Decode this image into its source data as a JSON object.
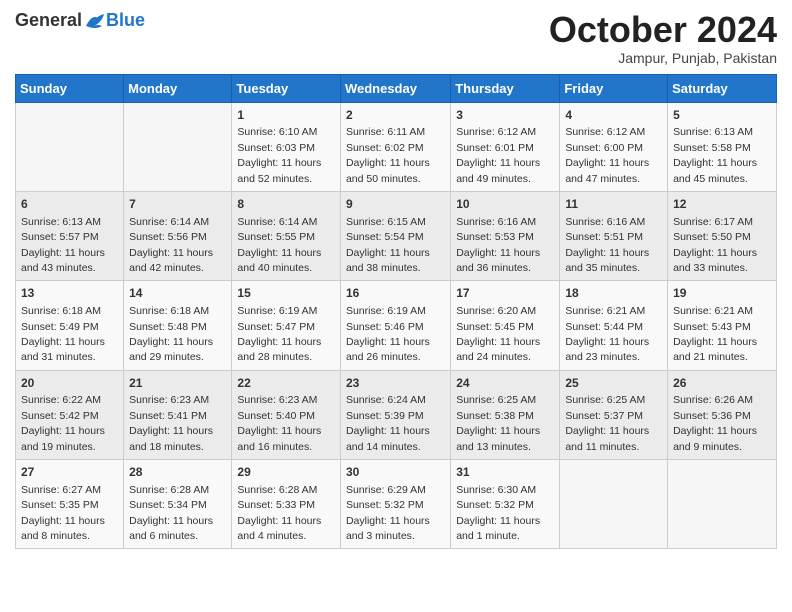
{
  "header": {
    "logo_general": "General",
    "logo_blue": "Blue",
    "month_title": "October 2024",
    "subtitle": "Jampur, Punjab, Pakistan"
  },
  "days_of_week": [
    "Sunday",
    "Monday",
    "Tuesday",
    "Wednesday",
    "Thursday",
    "Friday",
    "Saturday"
  ],
  "weeks": [
    [
      {
        "day": "",
        "info": ""
      },
      {
        "day": "",
        "info": ""
      },
      {
        "day": "1",
        "info": "Sunrise: 6:10 AM\nSunset: 6:03 PM\nDaylight: 11 hours and 52 minutes."
      },
      {
        "day": "2",
        "info": "Sunrise: 6:11 AM\nSunset: 6:02 PM\nDaylight: 11 hours and 50 minutes."
      },
      {
        "day": "3",
        "info": "Sunrise: 6:12 AM\nSunset: 6:01 PM\nDaylight: 11 hours and 49 minutes."
      },
      {
        "day": "4",
        "info": "Sunrise: 6:12 AM\nSunset: 6:00 PM\nDaylight: 11 hours and 47 minutes."
      },
      {
        "day": "5",
        "info": "Sunrise: 6:13 AM\nSunset: 5:58 PM\nDaylight: 11 hours and 45 minutes."
      }
    ],
    [
      {
        "day": "6",
        "info": "Sunrise: 6:13 AM\nSunset: 5:57 PM\nDaylight: 11 hours and 43 minutes."
      },
      {
        "day": "7",
        "info": "Sunrise: 6:14 AM\nSunset: 5:56 PM\nDaylight: 11 hours and 42 minutes."
      },
      {
        "day": "8",
        "info": "Sunrise: 6:14 AM\nSunset: 5:55 PM\nDaylight: 11 hours and 40 minutes."
      },
      {
        "day": "9",
        "info": "Sunrise: 6:15 AM\nSunset: 5:54 PM\nDaylight: 11 hours and 38 minutes."
      },
      {
        "day": "10",
        "info": "Sunrise: 6:16 AM\nSunset: 5:53 PM\nDaylight: 11 hours and 36 minutes."
      },
      {
        "day": "11",
        "info": "Sunrise: 6:16 AM\nSunset: 5:51 PM\nDaylight: 11 hours and 35 minutes."
      },
      {
        "day": "12",
        "info": "Sunrise: 6:17 AM\nSunset: 5:50 PM\nDaylight: 11 hours and 33 minutes."
      }
    ],
    [
      {
        "day": "13",
        "info": "Sunrise: 6:18 AM\nSunset: 5:49 PM\nDaylight: 11 hours and 31 minutes."
      },
      {
        "day": "14",
        "info": "Sunrise: 6:18 AM\nSunset: 5:48 PM\nDaylight: 11 hours and 29 minutes."
      },
      {
        "day": "15",
        "info": "Sunrise: 6:19 AM\nSunset: 5:47 PM\nDaylight: 11 hours and 28 minutes."
      },
      {
        "day": "16",
        "info": "Sunrise: 6:19 AM\nSunset: 5:46 PM\nDaylight: 11 hours and 26 minutes."
      },
      {
        "day": "17",
        "info": "Sunrise: 6:20 AM\nSunset: 5:45 PM\nDaylight: 11 hours and 24 minutes."
      },
      {
        "day": "18",
        "info": "Sunrise: 6:21 AM\nSunset: 5:44 PM\nDaylight: 11 hours and 23 minutes."
      },
      {
        "day": "19",
        "info": "Sunrise: 6:21 AM\nSunset: 5:43 PM\nDaylight: 11 hours and 21 minutes."
      }
    ],
    [
      {
        "day": "20",
        "info": "Sunrise: 6:22 AM\nSunset: 5:42 PM\nDaylight: 11 hours and 19 minutes."
      },
      {
        "day": "21",
        "info": "Sunrise: 6:23 AM\nSunset: 5:41 PM\nDaylight: 11 hours and 18 minutes."
      },
      {
        "day": "22",
        "info": "Sunrise: 6:23 AM\nSunset: 5:40 PM\nDaylight: 11 hours and 16 minutes."
      },
      {
        "day": "23",
        "info": "Sunrise: 6:24 AM\nSunset: 5:39 PM\nDaylight: 11 hours and 14 minutes."
      },
      {
        "day": "24",
        "info": "Sunrise: 6:25 AM\nSunset: 5:38 PM\nDaylight: 11 hours and 13 minutes."
      },
      {
        "day": "25",
        "info": "Sunrise: 6:25 AM\nSunset: 5:37 PM\nDaylight: 11 hours and 11 minutes."
      },
      {
        "day": "26",
        "info": "Sunrise: 6:26 AM\nSunset: 5:36 PM\nDaylight: 11 hours and 9 minutes."
      }
    ],
    [
      {
        "day": "27",
        "info": "Sunrise: 6:27 AM\nSunset: 5:35 PM\nDaylight: 11 hours and 8 minutes."
      },
      {
        "day": "28",
        "info": "Sunrise: 6:28 AM\nSunset: 5:34 PM\nDaylight: 11 hours and 6 minutes."
      },
      {
        "day": "29",
        "info": "Sunrise: 6:28 AM\nSunset: 5:33 PM\nDaylight: 11 hours and 4 minutes."
      },
      {
        "day": "30",
        "info": "Sunrise: 6:29 AM\nSunset: 5:32 PM\nDaylight: 11 hours and 3 minutes."
      },
      {
        "day": "31",
        "info": "Sunrise: 6:30 AM\nSunset: 5:32 PM\nDaylight: 11 hours and 1 minute."
      },
      {
        "day": "",
        "info": ""
      },
      {
        "day": "",
        "info": ""
      }
    ]
  ]
}
